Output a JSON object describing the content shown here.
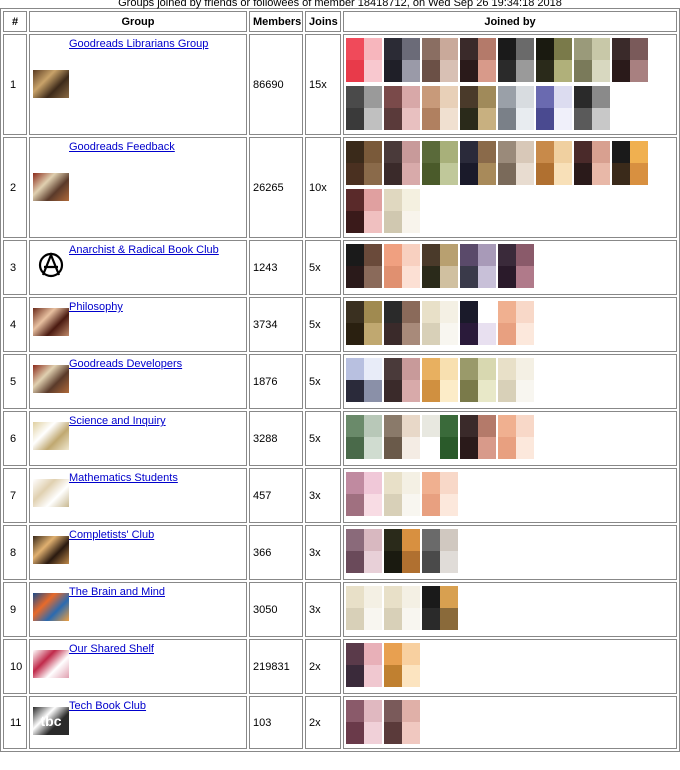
{
  "caption": "Groups joined by friends or followees of member 18418712, on Wed Sep 26 19:34:18 2018",
  "headers": {
    "num": "#",
    "group": "Group",
    "members": "Members",
    "joins": "Joins",
    "joined_by": "Joined by"
  },
  "rows": [
    {
      "num": "1",
      "name": "Goodreads Librarians Group",
      "members": "86690",
      "joins": "15x",
      "icon": "library-shelf-icon",
      "iconColors": [
        "#5a3b22",
        "#c9a36a",
        "#3d2a1a",
        "#8a6a44"
      ],
      "avatars": [
        [
          "#f04a5a",
          "#f7b6bd",
          "#e83a4a",
          "#f8c8cf"
        ],
        [
          "#2b2b35",
          "#6b6b78",
          "#1f1f28",
          "#9a9aa8"
        ],
        [
          "#8a6e62",
          "#c9a99a",
          "#6b5046",
          "#d8c0b4"
        ],
        [
          "#3a2a2a",
          "#b47a6a",
          "#2a1a1a",
          "#d89a8a"
        ],
        [
          "#1a1a1a",
          "#6a6a6a",
          "#2a2a2a",
          "#9a9a9a"
        ],
        [
          "#1a1a10",
          "#7a7a4a",
          "#2a2a1a",
          "#b0b07a"
        ],
        [
          "#9a9a7a",
          "#c8c8a8",
          "#7a7a5a",
          "#d8d8c0"
        ],
        [
          "#3a2a2a",
          "#7a5a5a",
          "#2a1a1a",
          "#a88080"
        ],
        [
          "#4a4a4a",
          "#9a9a9a",
          "#3a3a3a",
          "#c0c0c0"
        ],
        [
          "#7a4a4a",
          "#d8a8a8",
          "#5a3a3a",
          "#e8c0c0"
        ],
        [
          "#c89a7a",
          "#e8d0b8",
          "#b08060",
          "#f0e0d0"
        ],
        [
          "#4a3a2a",
          "#a08a5a",
          "#2a2a1a",
          "#c8b080"
        ],
        [
          "#9aa0a8",
          "#d8dce0",
          "#7a8088",
          "#e8ecf0"
        ],
        [
          "#6a6ab0",
          "#dcdcf0",
          "#4a4a90",
          "#f0f0fa"
        ],
        [
          "#2a2a2a",
          "#8a8a8a",
          "#5a5a5a",
          "#c8c8c8"
        ]
      ]
    },
    {
      "num": "2",
      "name": "Goodreads Feedback",
      "members": "26265",
      "joins": "10x",
      "icon": "books-stack-icon",
      "iconColors": [
        "#8a2a1a",
        "#e0d0b0",
        "#5a3a2a",
        "#b06a3a"
      ],
      "avatars": [
        [
          "#3a2a1a",
          "#7a5a3a",
          "#4a3020",
          "#8a6a4a"
        ],
        [
          "#4a3a3a",
          "#c89a9a",
          "#3a2a2a",
          "#d8aaaa"
        ],
        [
          "#5a6a3a",
          "#a8b07a",
          "#4a5a2a",
          "#c0c89a"
        ],
        [
          "#2a2a3a",
          "#8a6a4a",
          "#1a1a2a",
          "#a88a5a"
        ],
        [
          "#9a8a7a",
          "#d8c8b8",
          "#7a6a5a",
          "#e8dcd0"
        ],
        [
          "#c88a4a",
          "#f0d0a0",
          "#b07030",
          "#f8e0b8"
        ],
        [
          "#4a2a2a",
          "#d8a090",
          "#2a1a1a",
          "#e8b8a8"
        ],
        [
          "#1a1a1a",
          "#f0b050",
          "#3a2a1a",
          "#d89040"
        ],
        [
          "#5a2a2a",
          "#e0a0a0",
          "#3a1a1a",
          "#f0c0c0"
        ],
        [
          "#e0d8c0",
          "#f4f0e0",
          "#d0c8b0",
          "#f8f4ec"
        ]
      ]
    },
    {
      "num": "3",
      "name": "Anarchist & Radical Book Club",
      "members": "1243",
      "joins": "5x",
      "icon": "anarchy-symbol-icon",
      "iconColors": [
        "#ffffff",
        "#000000",
        "#ffffff",
        "#000000"
      ],
      "avatars": [
        [
          "#1a1a1a",
          "#6a4a3a",
          "#2a1a1a",
          "#8a6a5a"
        ],
        [
          "#f0a080",
          "#f8d0c0",
          "#e09070",
          "#fce0d4"
        ],
        [
          "#4a3a2a",
          "#b8a070",
          "#2a2a1a",
          "#d0c0a0"
        ],
        [
          "#5a4a6a",
          "#a89ab8",
          "#3a3a4a",
          "#c8c0d8"
        ],
        [
          "#3a2a3a",
          "#8a5a6a",
          "#2a1a2a",
          "#b07a8a"
        ]
      ]
    },
    {
      "num": "4",
      "name": "Philosophy",
      "members": "3734",
      "joins": "5x",
      "icon": "philosopher-portrait-icon",
      "iconColors": [
        "#6a2a1a",
        "#e8c0a0",
        "#4a1a10",
        "#c08a6a"
      ],
      "avatars": [
        [
          "#3a3020",
          "#a08a50",
          "#2a2010",
          "#c0a870"
        ],
        [
          "#2a2a2a",
          "#8a6a5a",
          "#3a2a2a",
          "#a88a7a"
        ],
        [
          "#e8e0c8",
          "#f4f0e4",
          "#d8d0b8",
          "#f8f6f0"
        ],
        [
          "#1a1a2a",
          "#ffffff",
          "#2a1a3a",
          "#e8e0f0"
        ],
        [
          "#f0b090",
          "#f8d8c8",
          "#e8a080",
          "#fce8dc"
        ]
      ]
    },
    {
      "num": "5",
      "name": "Goodreads Developers",
      "members": "1876",
      "joins": "5x",
      "icon": "books-stack-icon",
      "iconColors": [
        "#8a2a1a",
        "#e0d0b0",
        "#5a3a2a",
        "#b06a3a"
      ],
      "avatars": [
        [
          "#b8c0e0",
          "#e8ecf8",
          "#2a2a3a",
          "#8a90a8"
        ],
        [
          "#4a3a3a",
          "#c89a9a",
          "#3a2a2a",
          "#d8aaaa"
        ],
        [
          "#e8b060",
          "#f8e0b0",
          "#d09040",
          "#fcecc8"
        ],
        [
          "#9a9a6a",
          "#d8d8b0",
          "#7a7a4a",
          "#e8e8c8"
        ],
        [
          "#e8e0c8",
          "#f4f0e4",
          "#d8d0b8",
          "#f8f6f0"
        ]
      ]
    },
    {
      "num": "6",
      "name": "Science and Inquiry",
      "members": "3288",
      "joins": "5x",
      "icon": "dna-helix-icon",
      "iconColors": [
        "#e0d0a0",
        "#ffffff",
        "#c0a870",
        "#f0e8d0"
      ],
      "avatars": [
        [
          "#6a8a6a",
          "#b8c8b8",
          "#4a6a4a",
          "#d0dcd0"
        ],
        [
          "#8a7a6a",
          "#e8d8c8",
          "#6a5a4a",
          "#f4ece4"
        ],
        [
          "#e8e8e0",
          "#3a6a3a",
          "#ffffff",
          "#2a5a2a"
        ],
        [
          "#3a2a2a",
          "#b47a6a",
          "#2a1a1a",
          "#d89a8a"
        ],
        [
          "#f0b090",
          "#f8d8c8",
          "#e8a080",
          "#fce8dc"
        ]
      ]
    },
    {
      "num": "7",
      "name": "Mathematics Students",
      "members": "457",
      "joins": "3x",
      "icon": "vitruvian-man-icon",
      "iconColors": [
        "#ffffff",
        "#e0d0b0",
        "#ffffff",
        "#c8b890"
      ],
      "avatars": [
        [
          "#c08aa0",
          "#f0c8d8",
          "#a07080",
          "#f8dce4"
        ],
        [
          "#e8e0c8",
          "#f4f0e4",
          "#d8d0b8",
          "#f8f6f0"
        ],
        [
          "#f0b090",
          "#f8d8c8",
          "#e8a080",
          "#fce8dc"
        ]
      ]
    },
    {
      "num": "8",
      "name": "Completists' Club",
      "members": "366",
      "joins": "3x",
      "icon": "reader-photo-icon",
      "iconColors": [
        "#3a2a1a",
        "#e0b070",
        "#2a1a10",
        "#c08a4a"
      ],
      "avatars": [
        [
          "#8a6a7a",
          "#d8b8c0",
          "#6a4a5a",
          "#e8d0d8"
        ],
        [
          "#2a2a1a",
          "#d89040",
          "#1a1a10",
          "#b07030"
        ],
        [
          "#6a6a6a",
          "#d0c8c0",
          "#4a4a4a",
          "#e0dcd8"
        ]
      ]
    },
    {
      "num": "9",
      "name": "The Brain and Mind",
      "members": "3050",
      "joins": "3x",
      "icon": "brain-icon",
      "iconColors": [
        "#1a4a8a",
        "#e86a2a",
        "#2a6ab0",
        "#f0a040"
      ],
      "avatars": [
        [
          "#e8e0c8",
          "#f4f0e4",
          "#d8d0b8",
          "#f8f6f0"
        ],
        [
          "#e8e0c8",
          "#f4f0e4",
          "#d8d0b8",
          "#f8f6f0"
        ],
        [
          "#1a1a1a",
          "#d8a050",
          "#2a2a2a",
          "#8a6a3a"
        ]
      ]
    },
    {
      "num": "10",
      "name": "Our Shared Shelf",
      "members": "219831",
      "joins": "2x",
      "icon": "shared-shelf-logo-icon",
      "iconColors": [
        "#ffffff",
        "#c02a4a",
        "#ffffff",
        "#e0a0b0"
      ],
      "avatars": [
        [
          "#5a3a4a",
          "#e8b0b8",
          "#3a2a3a",
          "#f0c8d0"
        ],
        [
          "#e8a050",
          "#f8d0a0",
          "#c08030",
          "#fce4c0"
        ]
      ]
    },
    {
      "num": "11",
      "name": "Tech Book Club",
      "members": "103",
      "joins": "2x",
      "icon": "tbc-logo-icon",
      "iconColors": [
        "#2a2a2a",
        "#ffffff",
        "#2a2a2a",
        "#2a2a2a"
      ],
      "iconText": "tbc",
      "avatars": [
        [
          "#8a5a6a",
          "#e0b8c0",
          "#6a3a4a",
          "#f0d0d8"
        ],
        [
          "#7a5a5a",
          "#e0b0a8",
          "#5a3a3a",
          "#f0c8c0"
        ]
      ]
    }
  ]
}
